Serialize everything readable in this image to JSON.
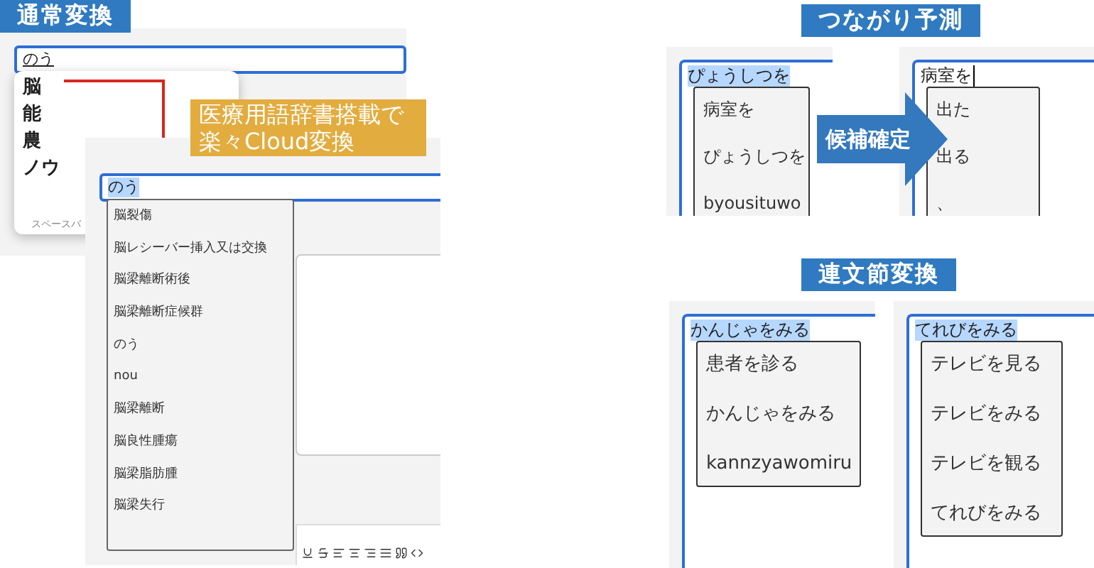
{
  "normal": {
    "label": "通常変換",
    "input": "のう",
    "highlighted": false,
    "underlined": true,
    "candidates": [
      "脳",
      "能",
      "農",
      "ノウ"
    ],
    "footer": "スペースバ"
  },
  "callout": {
    "lines": [
      "医療用語辞書搭載で",
      "楽々Cloud変換"
    ]
  },
  "cloud": {
    "input": "のう",
    "highlighted": true,
    "candidates": [
      "脳裂傷",
      "脳レシーバー挿入又は交換",
      "脳梁離断術後",
      "脳梁離断症候群",
      "のう",
      "nou",
      "脳梁離断",
      "脳良性腫瘍",
      "脳梁脂肪腫",
      "脳梁失行"
    ]
  },
  "prediction": {
    "label": "つながり予測",
    "arrow": "候補確定",
    "panels": [
      {
        "input": "ぴょうしつを",
        "highlighted": true,
        "candidates": [
          "病室を",
          "ぴょうしつを",
          "byousituwo"
        ]
      },
      {
        "input": "病室を",
        "highlighted": false,
        "cursor": true,
        "candidates": [
          "出た",
          "出る",
          "、"
        ]
      }
    ]
  },
  "multi_clause": {
    "label": "連文節変換",
    "panels": [
      {
        "input": "かんじゃをみる",
        "highlighted": true,
        "candidates": [
          "患者を診る",
          "かんじゃをみる",
          "kannzyawomiru"
        ]
      },
      {
        "input": "てれびをみる",
        "highlighted": true,
        "candidates": [
          "テレビを見る",
          "テレビをみる",
          "テレビを観る",
          "てれびをみる"
        ]
      }
    ]
  }
}
